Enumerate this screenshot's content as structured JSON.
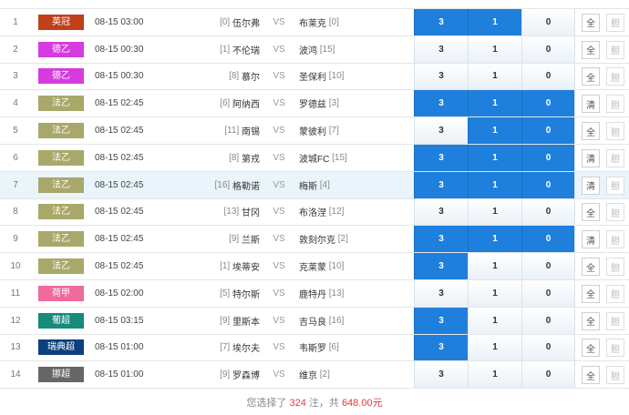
{
  "rows": [
    {
      "idx": "1",
      "league": "英冠",
      "color": "#c0401a",
      "time": "08-15 03:00",
      "home_rank": "[0]",
      "home": "伍尔弗",
      "vs": "VS",
      "away": "布莱克",
      "away_rank": "[0]",
      "odds": [
        "3",
        "1",
        "0"
      ],
      "selected": [
        true,
        true,
        false
      ],
      "btn1": "全",
      "btn2": "胆",
      "hl": false
    },
    {
      "idx": "2",
      "league": "德乙",
      "color": "#d63be0",
      "time": "08-15 00:30",
      "home_rank": "[1]",
      "home": "不伦瑞",
      "vs": "VS",
      "away": "波鸿",
      "away_rank": "[15]",
      "odds": [
        "3",
        "1",
        "0"
      ],
      "selected": [
        false,
        false,
        false
      ],
      "btn1": "全",
      "btn2": "胆",
      "hl": false
    },
    {
      "idx": "3",
      "league": "德乙",
      "color": "#d63be0",
      "time": "08-15 00:30",
      "home_rank": "[8]",
      "home": "慕尔",
      "vs": "VS",
      "away": "圣保利",
      "away_rank": "[10]",
      "odds": [
        "3",
        "1",
        "0"
      ],
      "selected": [
        false,
        false,
        false
      ],
      "btn1": "全",
      "btn2": "胆",
      "hl": false
    },
    {
      "idx": "4",
      "league": "法乙",
      "color": "#a8a86b",
      "time": "08-15 02:45",
      "home_rank": "[6]",
      "home": "阿纳西",
      "vs": "VS",
      "away": "罗德兹",
      "away_rank": "[3]",
      "odds": [
        "3",
        "1",
        "0"
      ],
      "selected": [
        true,
        true,
        true
      ],
      "btn1": "清",
      "btn2": "胆",
      "hl": false
    },
    {
      "idx": "5",
      "league": "法乙",
      "color": "#a8a86b",
      "time": "08-15 02:45",
      "home_rank": "[11]",
      "home": "南锡",
      "vs": "VS",
      "away": "蒙彼利",
      "away_rank": "[7]",
      "odds": [
        "3",
        "1",
        "0"
      ],
      "selected": [
        false,
        true,
        true
      ],
      "btn1": "全",
      "btn2": "胆",
      "hl": false
    },
    {
      "idx": "6",
      "league": "法乙",
      "color": "#a8a86b",
      "time": "08-15 02:45",
      "home_rank": "[8]",
      "home": "第戎",
      "vs": "VS",
      "away": "波城FC",
      "away_rank": "[15]",
      "odds": [
        "3",
        "1",
        "0"
      ],
      "selected": [
        true,
        true,
        true
      ],
      "btn1": "清",
      "btn2": "胆",
      "hl": false
    },
    {
      "idx": "7",
      "league": "法乙",
      "color": "#a8a86b",
      "time": "08-15 02:45",
      "home_rank": "[16]",
      "home": "格勒诺",
      "vs": "VS",
      "away": "梅斯",
      "away_rank": "[4]",
      "odds": [
        "3",
        "1",
        "0"
      ],
      "selected": [
        true,
        true,
        true
      ],
      "btn1": "清",
      "btn2": "胆",
      "hl": true
    },
    {
      "idx": "8",
      "league": "法乙",
      "color": "#a8a86b",
      "time": "08-15 02:45",
      "home_rank": "[13]",
      "home": "甘冈",
      "vs": "VS",
      "away": "布洛涅",
      "away_rank": "[12]",
      "odds": [
        "3",
        "1",
        "0"
      ],
      "selected": [
        false,
        false,
        false
      ],
      "btn1": "全",
      "btn2": "胆",
      "hl": false
    },
    {
      "idx": "9",
      "league": "法乙",
      "color": "#a8a86b",
      "time": "08-15 02:45",
      "home_rank": "[9]",
      "home": "兰斯",
      "vs": "VS",
      "away": "敦刻尔克",
      "away_rank": "[2]",
      "odds": [
        "3",
        "1",
        "0"
      ],
      "selected": [
        true,
        true,
        true
      ],
      "btn1": "清",
      "btn2": "胆",
      "hl": false
    },
    {
      "idx": "10",
      "league": "法乙",
      "color": "#a8a86b",
      "time": "08-15 02:45",
      "home_rank": "[1]",
      "home": "埃蒂安",
      "vs": "VS",
      "away": "克莱蒙",
      "away_rank": "[10]",
      "odds": [
        "3",
        "1",
        "0"
      ],
      "selected": [
        true,
        false,
        false
      ],
      "btn1": "全",
      "btn2": "胆",
      "hl": false
    },
    {
      "idx": "11",
      "league": "荷甲",
      "color": "#f06a9b",
      "time": "08-15 02:00",
      "home_rank": "[5]",
      "home": "特尔斯",
      "vs": "VS",
      "away": "鹿特丹",
      "away_rank": "[13]",
      "odds": [
        "3",
        "1",
        "0"
      ],
      "selected": [
        false,
        false,
        false
      ],
      "btn1": "全",
      "btn2": "胆",
      "hl": false
    },
    {
      "idx": "12",
      "league": "葡超",
      "color": "#168b7a",
      "time": "08-15 03:15",
      "home_rank": "[9]",
      "home": "里斯本",
      "vs": "VS",
      "away": "吉马良",
      "away_rank": "[16]",
      "odds": [
        "3",
        "1",
        "0"
      ],
      "selected": [
        true,
        false,
        false
      ],
      "btn1": "全",
      "btn2": "胆",
      "hl": false
    },
    {
      "idx": "13",
      "league": "瑞典超",
      "color": "#0e3f7e",
      "time": "08-15 01:00",
      "home_rank": "[7]",
      "home": "埃尔夫",
      "vs": "VS",
      "away": "韦斯罗",
      "away_rank": "[6]",
      "odds": [
        "3",
        "1",
        "0"
      ],
      "selected": [
        true,
        false,
        false
      ],
      "btn1": "全",
      "btn2": "胆",
      "hl": false
    },
    {
      "idx": "14",
      "league": "挪超",
      "color": "#666666",
      "time": "08-15 01:00",
      "home_rank": "[9]",
      "home": "罗森博",
      "vs": "VS",
      "away": "维京",
      "away_rank": "[2]",
      "odds": [
        "3",
        "1",
        "0"
      ],
      "selected": [
        false,
        false,
        false
      ],
      "btn1": "全",
      "btn2": "胆",
      "hl": false
    }
  ],
  "summary": {
    "prefix": "您选择了",
    "count": "324",
    "mid": "注，共",
    "amount": "648.00元"
  },
  "colors": {
    "selected": "#1f7fdc",
    "highlight_row": "#e9f4fb",
    "accent_red": "#e4393c"
  }
}
